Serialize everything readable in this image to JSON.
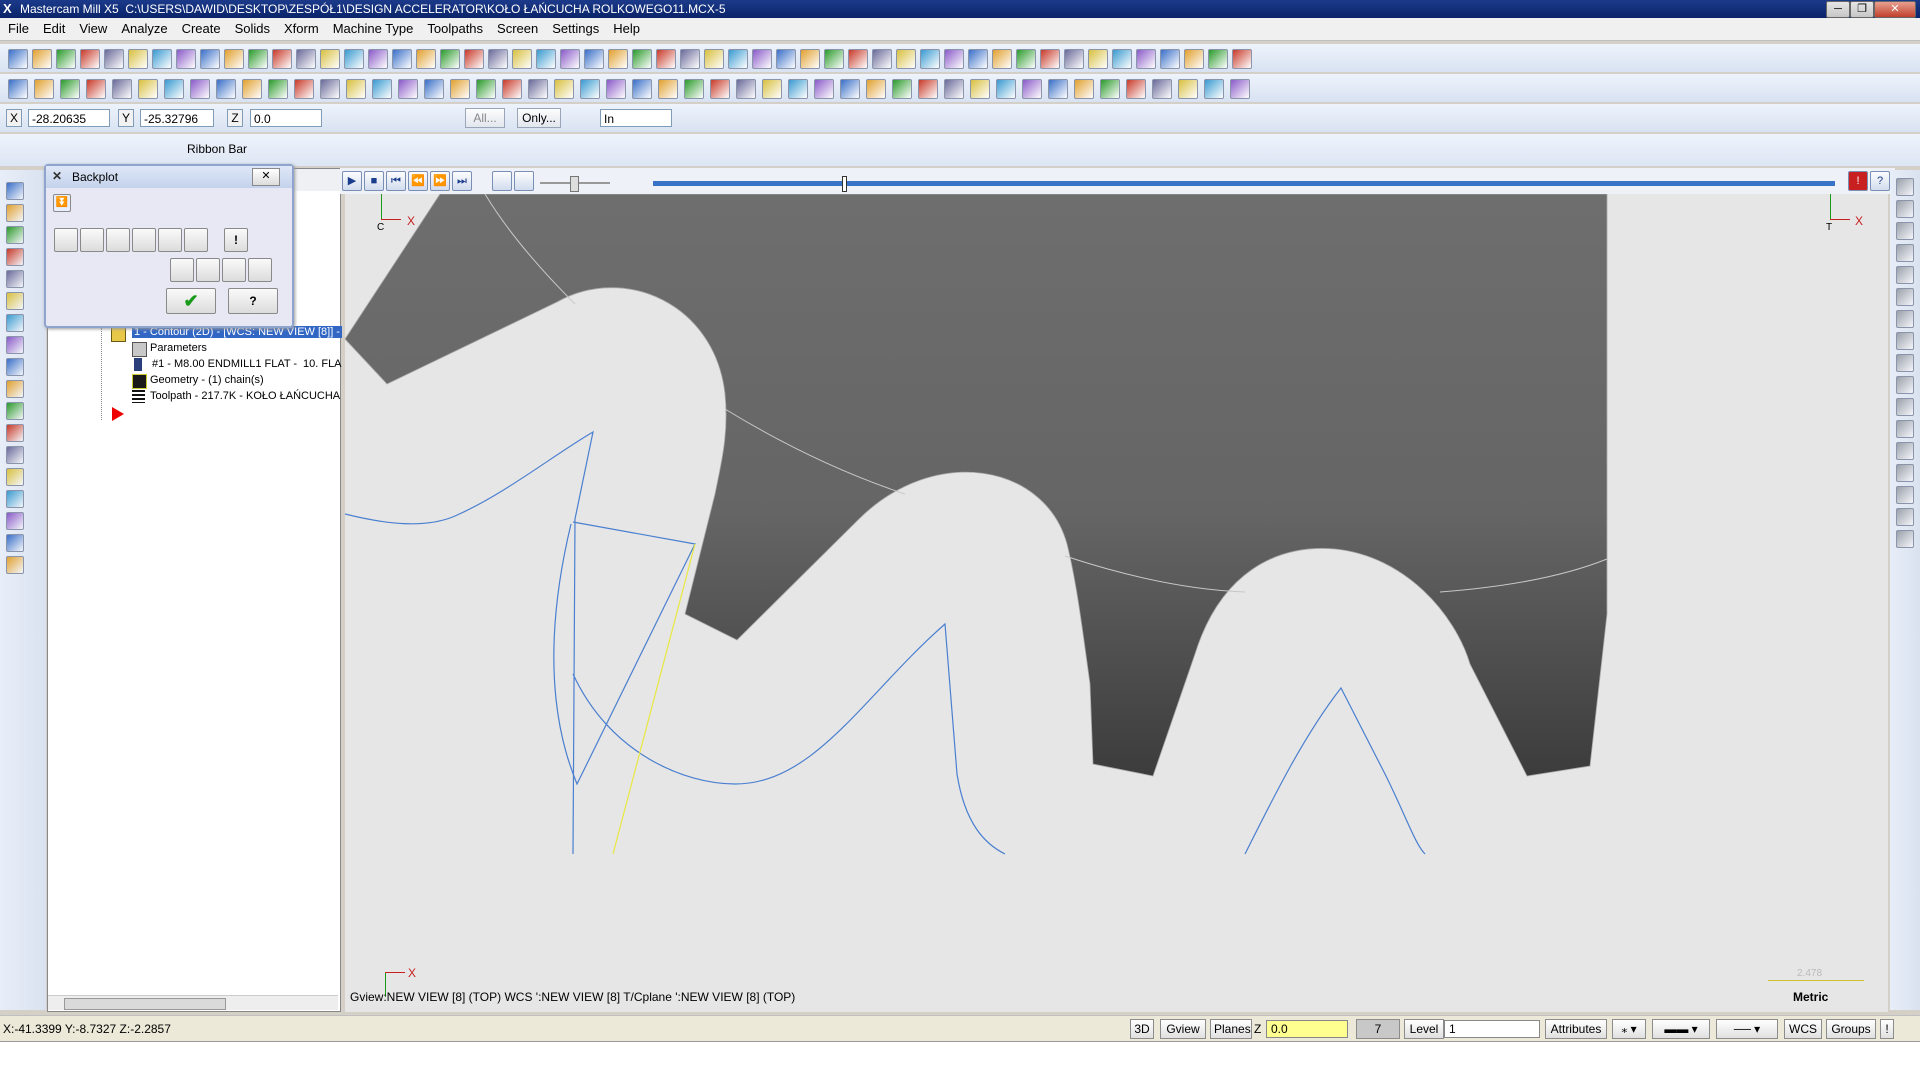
{
  "window": {
    "app": "Mastercam Mill X5",
    "path": "C:\\USERS\\DAWID\\DESKTOP\\ZESPÓŁ1\\DESIGN ACCELERATOR\\KOŁO ŁAŃCUCHA ROLKOWEGO11.MCX-5"
  },
  "menu": [
    "File",
    "Edit",
    "View",
    "Analyze",
    "Create",
    "Solids",
    "Xform",
    "Machine Type",
    "Toolpaths",
    "Screen",
    "Settings",
    "Help"
  ],
  "coords": {
    "x_label": "X",
    "x_value": "-28.20635",
    "y_label": "Y",
    "y_value": "-25.32796",
    "z_label": "Z",
    "z_value": "0.0",
    "all_btn": "All...",
    "only_btn": "Only...",
    "unit": "In"
  },
  "ribbon_bar": "Ribbon Bar",
  "backplot": {
    "title": "Backplot"
  },
  "tree": {
    "operation": "1 - Contour (2D) - [WCS: NEW VIEW [8]] -",
    "parameters": "Parameters",
    "tool": "#1 - M8.00 ENDMILL1 FLAT -",
    "tool_extra": "10. FLA",
    "geometry": "Geometry - (1) chain(s)",
    "toolpath": "Toolpath - 217.7K - KOŁO ŁAŃCUCHA"
  },
  "viewport": {
    "axis_x": "X",
    "axis_c": "C",
    "axis_t": "T",
    "gview_info": "Gview:NEW VIEW [8] (TOP)   WCS ':NEW VIEW [8]   T/Cplane ':NEW VIEW [8] (TOP)",
    "scale_value": "2.478",
    "scale_unit": "Metric"
  },
  "status": {
    "cursor": "X:-41.3399   Y:-8.7327   Z:-2.2857",
    "btn_3d": "3D",
    "btn_gview": "Gview",
    "btn_planes": "Planes",
    "z_label": "Z",
    "z_value": "0.0",
    "color_num": "7",
    "level_label": "Level",
    "level_value": "1",
    "attributes": "Attributes",
    "wcs": "WCS",
    "groups": "Groups"
  },
  "colors": {
    "toolpath": "#4a7fd0",
    "yellow_line": "#e8e840",
    "gear_dark": "#6e6e6e",
    "background": "#e6e6e6",
    "selection": "#3166c4"
  }
}
